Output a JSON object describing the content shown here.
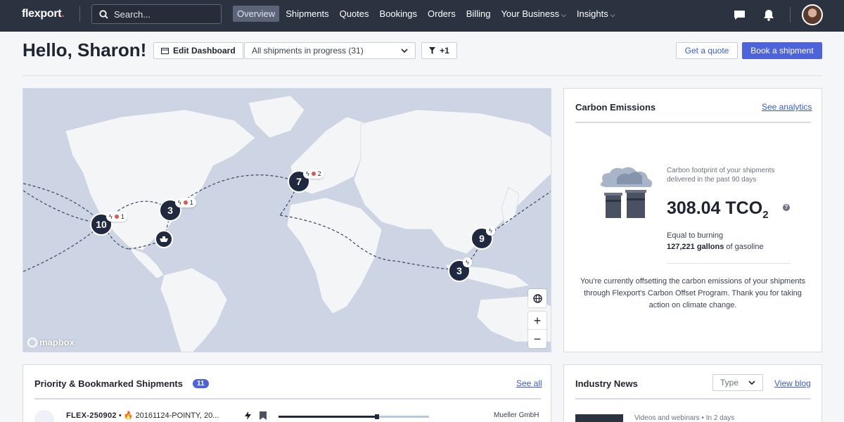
{
  "nav": {
    "logo": "flexport",
    "search_placeholder": "Search...",
    "links": [
      {
        "label": "Overview",
        "active": true
      },
      {
        "label": "Shipments"
      },
      {
        "label": "Quotes"
      },
      {
        "label": "Bookings"
      },
      {
        "label": "Orders"
      },
      {
        "label": "Billing"
      },
      {
        "label": "Your Business",
        "dropdown": true
      },
      {
        "label": "Insights",
        "dropdown": true
      }
    ],
    "icons": [
      "chat-icon",
      "bell-icon"
    ]
  },
  "header": {
    "greeting": "Hello, Sharon!",
    "edit_dashboard": "Edit Dashboard",
    "shipment_filter": "All shipments in progress (31)",
    "filter_count": "+1",
    "get_quote": "Get a quote",
    "book_shipment": "Book a shipment"
  },
  "map": {
    "attribution": "mapbox",
    "clusters": [
      {
        "count": "10",
        "badge_count": "1"
      },
      {
        "count": "3",
        "badge_count": "1"
      },
      {
        "count": "7",
        "badge_count": "2"
      },
      {
        "count": "9"
      },
      {
        "count": "3"
      }
    ],
    "controls": {
      "zoom_in": "+",
      "zoom_out": "−"
    }
  },
  "carbon": {
    "title": "Carbon Emissions",
    "link": "See analytics",
    "footprint_label": "Carbon footprint of your shipments delivered in the past 90 days",
    "value": "308.04 TCO",
    "value_sub": "2",
    "help": "?",
    "equal_label": "Equal to burning",
    "gallons": "127,221 gallons",
    "gallons_suffix": " of gasoline",
    "offset_text": "You're currently offsetting the carbon emissions of your shipments through Flexport's Carbon Offset Program. Thank you for taking action on climate change."
  },
  "priority": {
    "title": "Priority & Bookmarked Shipments",
    "count": "11",
    "see_all": "See all",
    "rows": [
      {
        "id": "FLEX-250902",
        "sep": " • ",
        "ref": "🔥 20161124-POINTY, 20...",
        "company": "Mueller GmbH",
        "progress": 0.64
      }
    ]
  },
  "news": {
    "title": "Industry News",
    "type_label": "Type",
    "view_blog": "View blog",
    "items": [
      {
        "meta": "Videos and webinars • In 2 days"
      }
    ]
  },
  "colors": {
    "nav_bg": "#2b3240",
    "accent": "#4c63d9",
    "cluster": "#1f2940",
    "alert": "#e2564e",
    "map_water": "#cdd5e4"
  }
}
